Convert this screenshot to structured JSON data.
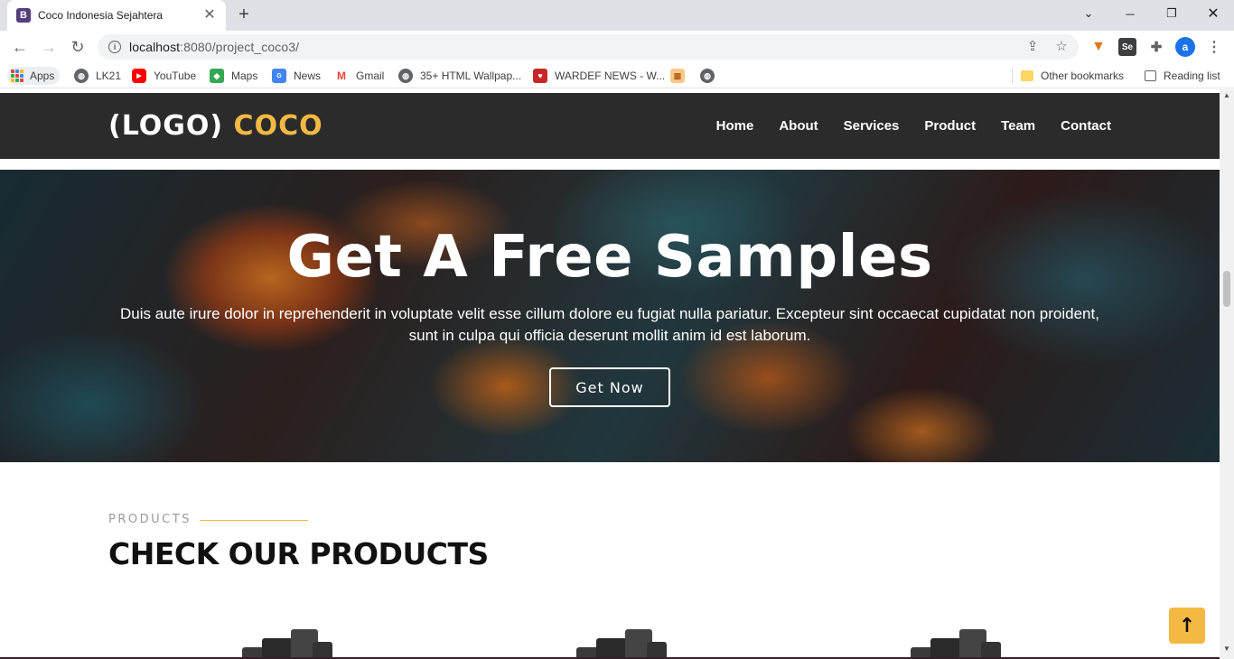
{
  "browser": {
    "tab_title": "Coco Indonesia Sejahtera",
    "tab_favicon": "B",
    "url_host": "localhost",
    "url_rest": ":8080/project_coco3/",
    "profile_initial": "a",
    "ext_selenium": "Se"
  },
  "bookmarks": {
    "apps": "Apps",
    "items": [
      "LK21",
      "YouTube",
      "Maps",
      "News",
      "Gmail",
      "35+ HTML Wallpap...",
      "WARDEF NEWS - W..."
    ],
    "other": "Other bookmarks",
    "reading": "Reading list"
  },
  "site": {
    "logo_main": "(LOGO) ",
    "logo_accent": "COCO",
    "accent_color": "#f4b942",
    "nav": [
      "Home",
      "About",
      "Services",
      "Product",
      "Team",
      "Contact"
    ]
  },
  "hero": {
    "title": "Get A Free Samples",
    "text": "Duis aute irure dolor in reprehenderit in voluptate velit esse cillum dolore eu fugiat nulla pariatur. Excepteur sint occaecat cupidatat non proident, sunt in culpa qui officia deserunt mollit anim id est laborum.",
    "button": "Get Now"
  },
  "products": {
    "eyebrow": "PRODUCTS",
    "title": "CHECK OUR PRODUCTS"
  }
}
